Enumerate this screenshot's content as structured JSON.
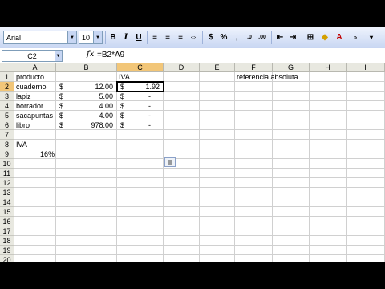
{
  "toolbar": {
    "font": "Arial",
    "size": "10",
    "bold": "B",
    "italic": "I",
    "underline": "U",
    "currency": "$",
    "percent": "%"
  },
  "formula_bar": {
    "name_box": "C2",
    "fx": "fx",
    "formula": "=B2*A9"
  },
  "columns": [
    "A",
    "B",
    "C",
    "D",
    "E",
    "F",
    "G",
    "H",
    "I"
  ],
  "rows": [
    "1",
    "2",
    "3",
    "4",
    "5",
    "6",
    "7",
    "8",
    "9",
    "10",
    "11",
    "12",
    "13",
    "14",
    "15",
    "16",
    "17",
    "18",
    "19",
    "20"
  ],
  "cells": {
    "A1": "producto",
    "A2": "cuaderno",
    "A3": "lapiz",
    "A4": "borrador",
    "A5": "sacapuntas",
    "A6": "libro",
    "A8": "IVA",
    "A9": "16%",
    "B2_sym": "$",
    "B2": "12.00",
    "B3_sym": "$",
    "B3": "5.00",
    "B4_sym": "$",
    "B4": "4.00",
    "B5_sym": "$",
    "B5": "4.00",
    "B6_sym": "$",
    "B6": "978.00",
    "C1": "IVA",
    "C2_sym": "$",
    "C2": "1.92",
    "C3_sym": "$",
    "C3": "-",
    "C4_sym": "$",
    "C4": "-",
    "C5_sym": "$",
    "C5": "-",
    "C6_sym": "$",
    "C6": "-",
    "F1": "referencia absoluta"
  },
  "active_cell": "C2"
}
